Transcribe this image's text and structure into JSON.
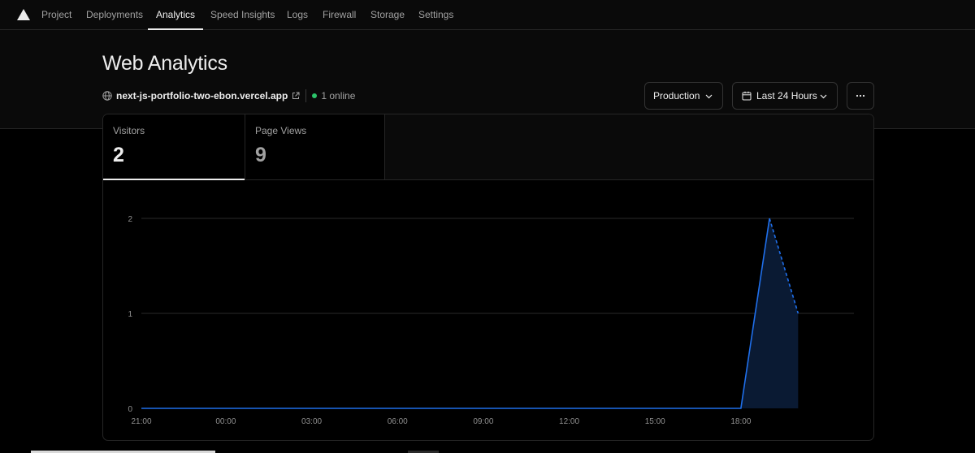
{
  "nav": {
    "tabs": [
      {
        "label": "Project"
      },
      {
        "label": "Deployments"
      },
      {
        "label": "Analytics"
      },
      {
        "label": "Speed Insights"
      },
      {
        "label": "Logs"
      },
      {
        "label": "Firewall"
      },
      {
        "label": "Storage"
      },
      {
        "label": "Settings"
      }
    ],
    "active_tab": "Analytics"
  },
  "header": {
    "title": "Web Analytics",
    "site": "next-js-portfolio-two-ebon.vercel.app",
    "online": "1 online",
    "environment_label": "Production",
    "range_label": "Last 24 Hours",
    "more_label": "···"
  },
  "metrics": {
    "visitors": {
      "label": "Visitors",
      "value": "2"
    },
    "page_views": {
      "label": "Page Views",
      "value": "9"
    }
  },
  "colors": {
    "accent": "#1f6feb",
    "area_fill": "#0a1a33",
    "online": "#2bc46a"
  },
  "chart_data": {
    "type": "area",
    "metric": "Visitors",
    "y_ticks": [
      "0",
      "1",
      "2"
    ],
    "ylim": [
      0,
      2
    ],
    "x_tick_labels": [
      "21:00",
      "00:00",
      "03:00",
      "06:00",
      "09:00",
      "12:00",
      "15:00",
      "18:00"
    ],
    "x_hours": [
      -2.95,
      0,
      3,
      6,
      9,
      12,
      15,
      18,
      21.95
    ],
    "series": [
      {
        "x": [
          "20:00",
          "21:00",
          "22:00",
          "23:00",
          "00:00",
          "01:00",
          "02:00",
          "03:00",
          "04:00",
          "05:00",
          "06:00",
          "07:00",
          "08:00",
          "09:00",
          "10:00",
          "11:00",
          "12:00",
          "13:00",
          "14:00",
          "15:00",
          "16:00",
          "17:00",
          "18:00",
          "19:00",
          "20:00"
        ],
        "values": [
          0,
          0,
          0,
          0,
          0,
          0,
          0,
          0,
          0,
          0,
          0,
          0,
          0,
          0,
          0,
          0,
          0,
          0,
          0,
          0,
          0,
          0,
          0,
          2,
          1
        ],
        "partial_last": true
      }
    ],
    "grid": true
  }
}
